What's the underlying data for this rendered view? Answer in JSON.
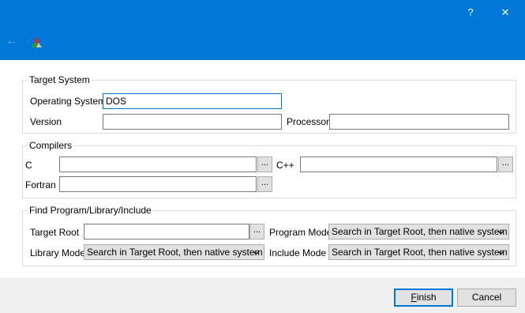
{
  "window": {
    "help_glyph": "?",
    "close_glyph": "✕"
  },
  "header": {
    "back_glyph": "←"
  },
  "target_system": {
    "legend": "Target System",
    "os_label": "Operating System",
    "os_value": "DOS",
    "version_label": "Version",
    "version_value": "",
    "processor_label": "Processor",
    "processor_value": ""
  },
  "compilers": {
    "legend": "Compilers",
    "c_label": "C",
    "c_value": "",
    "cpp_label": "C++",
    "cpp_value": "",
    "fortran_label": "Fortran",
    "fortran_value": "",
    "browse_label": "..."
  },
  "find": {
    "legend": "Find Program/Library/Include",
    "target_root_label": "Target Root",
    "target_root_value": "",
    "program_mode_label": "Program Mode",
    "program_mode_value": "Search in Target Root, then native system",
    "library_mode_label": "Library Mode",
    "library_mode_value": "Search in Target Root, then native system",
    "include_mode_label": "Include Mode",
    "include_mode_value": "Search in Target Root, then native system"
  },
  "buttons": {
    "finish_mnemonic": "F",
    "finish_rest": "inish",
    "cancel": "Cancel"
  },
  "colors": {
    "accent": "#0078d7",
    "content_bg": "#ffffff",
    "dialog_bg": "#f0f0f0"
  }
}
